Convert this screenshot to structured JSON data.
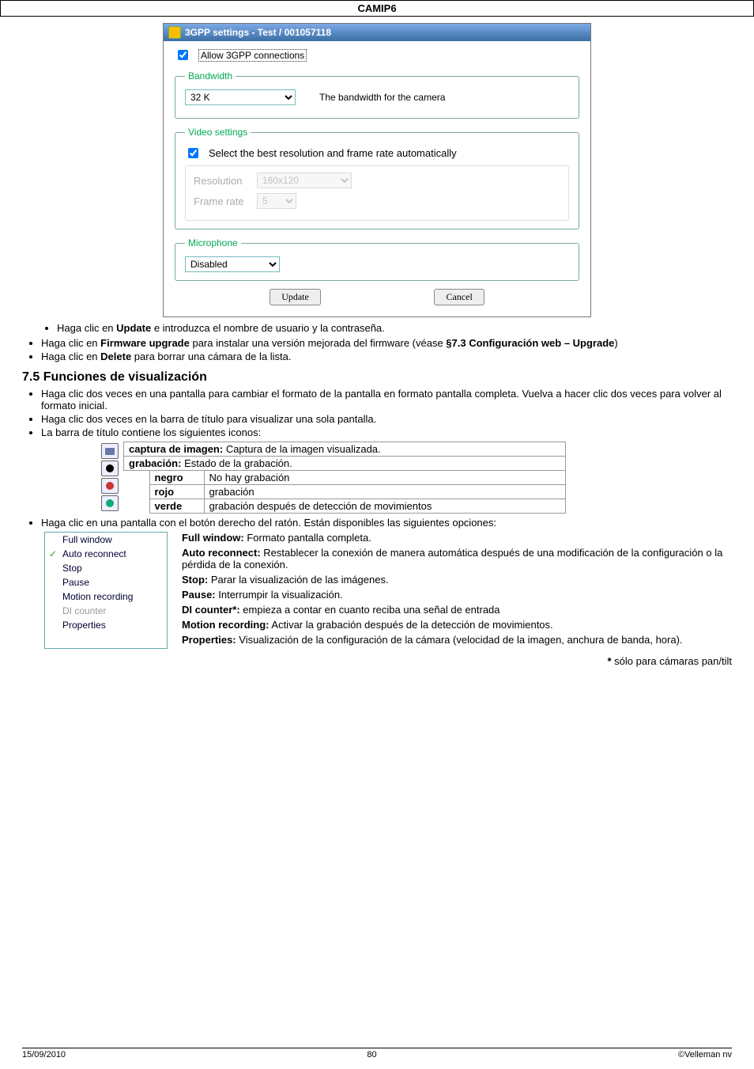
{
  "header": {
    "title": "CAMIP6"
  },
  "dialog": {
    "title": "3GPP settings - Test / 001057118",
    "allow_label": "Allow 3GPP connections",
    "bandwidth": {
      "legend": "Bandwidth",
      "value": "32 K",
      "note": "The bandwidth for the camera"
    },
    "video": {
      "legend": "Video settings",
      "select_auto": "Select the best resolution and frame rate automatically",
      "resolution_label": "Resolution",
      "resolution_value": "160x120",
      "frame_label": "Frame rate",
      "frame_value": "5"
    },
    "mic": {
      "legend": "Microphone",
      "value": "Disabled"
    },
    "update_btn": "Update",
    "cancel_btn": "Cancel"
  },
  "bullets1": {
    "a": "Haga clic en ",
    "a_b": "Update",
    "a2": " e introduzca el nombre de usuario y la contraseña.",
    "b": "Haga clic en ",
    "b_b": "Firmware upgrade",
    "b2": " para instalar una versión mejorada del firmware (véase ",
    "b_b2": "§7.3 Configuración web – Upgrade",
    "b3": ")",
    "c": "Haga clic en ",
    "c_b": "Delete",
    "c2": " para borrar una cámara de la lista."
  },
  "section_title": "7.5 Funciones de visualización",
  "bullets2": {
    "a": "Haga clic dos veces en una pantalla para cambiar el formato de la pantalla en formato pantalla completa. Vuelva a hacer clic dos veces para volver al formato inicial.",
    "b": "Haga clic dos veces en la barra de título para visualizar una sola pantalla.",
    "c": "La barra de título contiene los siguientes iconos:"
  },
  "legend": {
    "captura_b": "captura de imagen:",
    "captura": " Captura de la imagen visualizada.",
    "grab_b": "grabación:",
    "grab": " Estado de la grabación.",
    "negro_l": "negro",
    "negro_v": "No hay grabación",
    "rojo_l": "rojo",
    "rojo_v": "grabación",
    "verde_l": "verde",
    "verde_v": "grabación después de detección de movimientos"
  },
  "bullets3": "Haga clic en una pantalla con el botón derecho del ratón. Están disponibles las siguientes opciones:",
  "menu": {
    "full": "Full window",
    "auto": "Auto reconnect",
    "stop": "Stop",
    "pause": "Pause",
    "motion": "Motion recording",
    "di": "DI counter",
    "prop": "Properties"
  },
  "defs": {
    "full_b": "Full window:",
    "full": " Formato pantalla completa.",
    "auto_b": "Auto reconnect:",
    "auto": " Restablecer la conexión de manera automática después de una modificación de la configuración o la pérdida de la conexión.",
    "stop_b": "Stop:",
    "stop": " Parar la visualización de las imágenes.",
    "pause_b": "Pause:",
    "pause": " Interrumpir la visualización.",
    "di_b": "DI counter*:",
    "di": " empieza a contar en cuanto reciba una señal de entrada",
    "mot_b": "Motion recording:",
    "mot": " Activar la grabación después de la detección de movimientos.",
    "prop_b": "Properties:",
    "prop": " Visualización de la configuración de la cámara (velocidad de la imagen, anchura de banda, hora)."
  },
  "asterisk_b": "*",
  "asterisk": " sólo para cámaras pan/tilt",
  "footer": {
    "left": "15/09/2010",
    "center": "80",
    "right": "©Velleman nv"
  }
}
